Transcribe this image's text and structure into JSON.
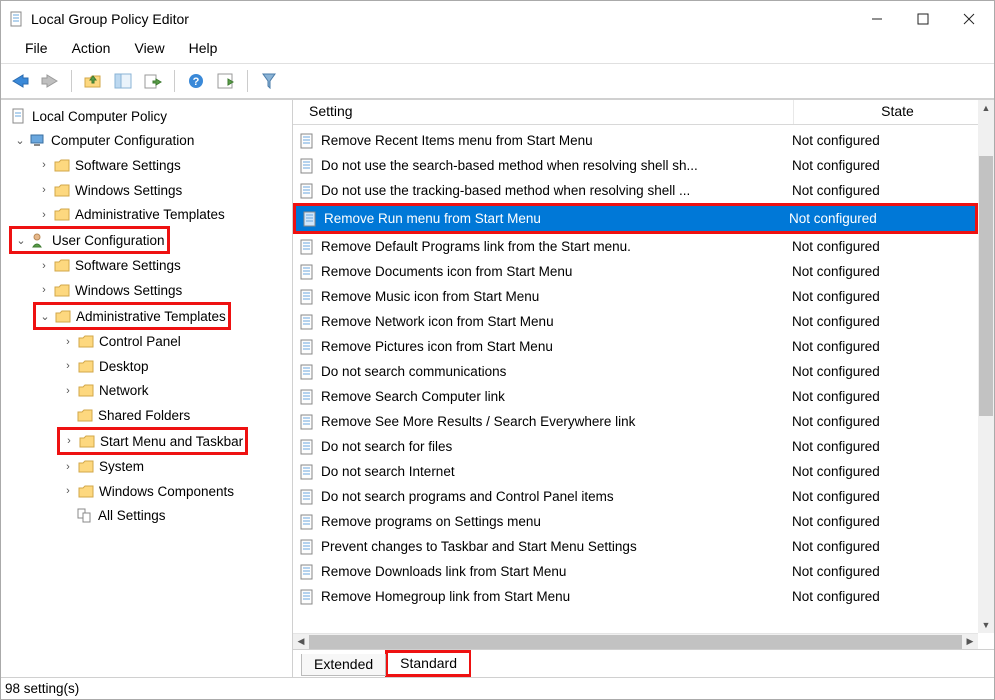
{
  "window": {
    "title": "Local Group Policy Editor"
  },
  "menu": [
    "File",
    "Action",
    "View",
    "Help"
  ],
  "tree": {
    "root": "Local Computer Policy",
    "cc": "Computer Configuration",
    "cc_sw": "Software Settings",
    "cc_ws": "Windows Settings",
    "cc_at": "Administrative Templates",
    "uc": "User Configuration",
    "uc_sw": "Software Settings",
    "uc_ws": "Windows Settings",
    "uc_at": "Administrative Templates",
    "uc_at_cp": "Control Panel",
    "uc_at_dt": "Desktop",
    "uc_at_nw": "Network",
    "uc_at_sf": "Shared Folders",
    "uc_at_sm": "Start Menu and Taskbar",
    "uc_at_sys": "System",
    "uc_at_wc": "Windows Components",
    "uc_at_all": "All Settings"
  },
  "columns": {
    "setting": "Setting",
    "state": "State"
  },
  "settings": [
    {
      "name": "Remove Recent Items menu from Start Menu",
      "state": "Not configured",
      "selected": false
    },
    {
      "name": "Do not use the search-based method when resolving shell sh...",
      "state": "Not configured",
      "selected": false
    },
    {
      "name": "Do not use the tracking-based method when resolving shell ...",
      "state": "Not configured",
      "selected": false
    },
    {
      "name": "Remove Run menu from Start Menu",
      "state": "Not configured",
      "selected": true
    },
    {
      "name": "Remove Default Programs link from the Start menu.",
      "state": "Not configured",
      "selected": false
    },
    {
      "name": "Remove Documents icon from Start Menu",
      "state": "Not configured",
      "selected": false
    },
    {
      "name": "Remove Music icon from Start Menu",
      "state": "Not configured",
      "selected": false
    },
    {
      "name": "Remove Network icon from Start Menu",
      "state": "Not configured",
      "selected": false
    },
    {
      "name": "Remove Pictures icon from Start Menu",
      "state": "Not configured",
      "selected": false
    },
    {
      "name": "Do not search communications",
      "state": "Not configured",
      "selected": false
    },
    {
      "name": "Remove Search Computer link",
      "state": "Not configured",
      "selected": false
    },
    {
      "name": "Remove See More Results / Search Everywhere link",
      "state": "Not configured",
      "selected": false
    },
    {
      "name": "Do not search for files",
      "state": "Not configured",
      "selected": false
    },
    {
      "name": "Do not search Internet",
      "state": "Not configured",
      "selected": false
    },
    {
      "name": "Do not search programs and Control Panel items",
      "state": "Not configured",
      "selected": false
    },
    {
      "name": "Remove programs on Settings menu",
      "state": "Not configured",
      "selected": false
    },
    {
      "name": "Prevent changes to Taskbar and Start Menu Settings",
      "state": "Not configured",
      "selected": false
    },
    {
      "name": "Remove Downloads link from Start Menu",
      "state": "Not configured",
      "selected": false
    },
    {
      "name": "Remove Homegroup link from Start Menu",
      "state": "Not configured",
      "selected": false
    }
  ],
  "tabs": {
    "extended": "Extended",
    "standard": "Standard"
  },
  "status": "98 setting(s)"
}
